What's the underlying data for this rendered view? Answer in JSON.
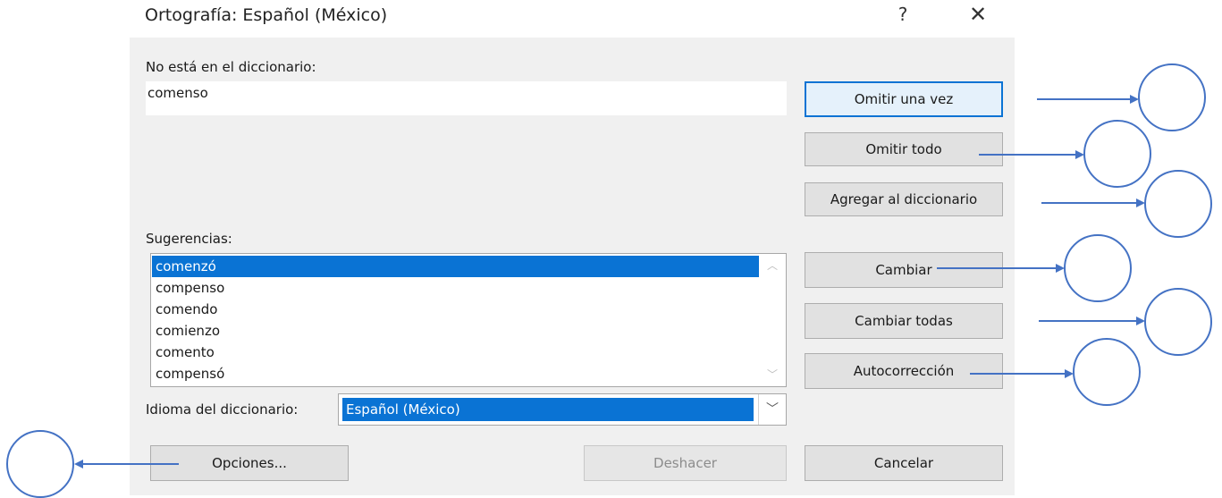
{
  "window": {
    "title": "Ortografía: Español (México)",
    "help_glyph": "?",
    "close_glyph": "✕"
  },
  "not_in_dictionary": {
    "label": "No está en el diccionario:",
    "value": "comenso"
  },
  "suggestions": {
    "label": "Sugerencias:",
    "items": [
      "comenzó",
      "compenso",
      "comendo",
      "comienzo",
      "comento",
      "compensó"
    ],
    "selected_index": 0
  },
  "dictionary_language": {
    "label": "Idioma del diccionario:",
    "value": "Español (México)"
  },
  "buttons": {
    "ignore_once": "Omitir una vez",
    "ignore_all": "Omitir todo",
    "add_to_dictionary": "Agregar al diccionario",
    "change": "Cambiar",
    "change_all": "Cambiar todas",
    "autocorrect": "Autocorrección",
    "options": "Opciones...",
    "undo": "Deshacer",
    "cancel": "Cancelar"
  },
  "colors": {
    "accent": "#0a73d4",
    "annotation": "#4472c4",
    "dialog_bg": "#f0f0f0"
  }
}
